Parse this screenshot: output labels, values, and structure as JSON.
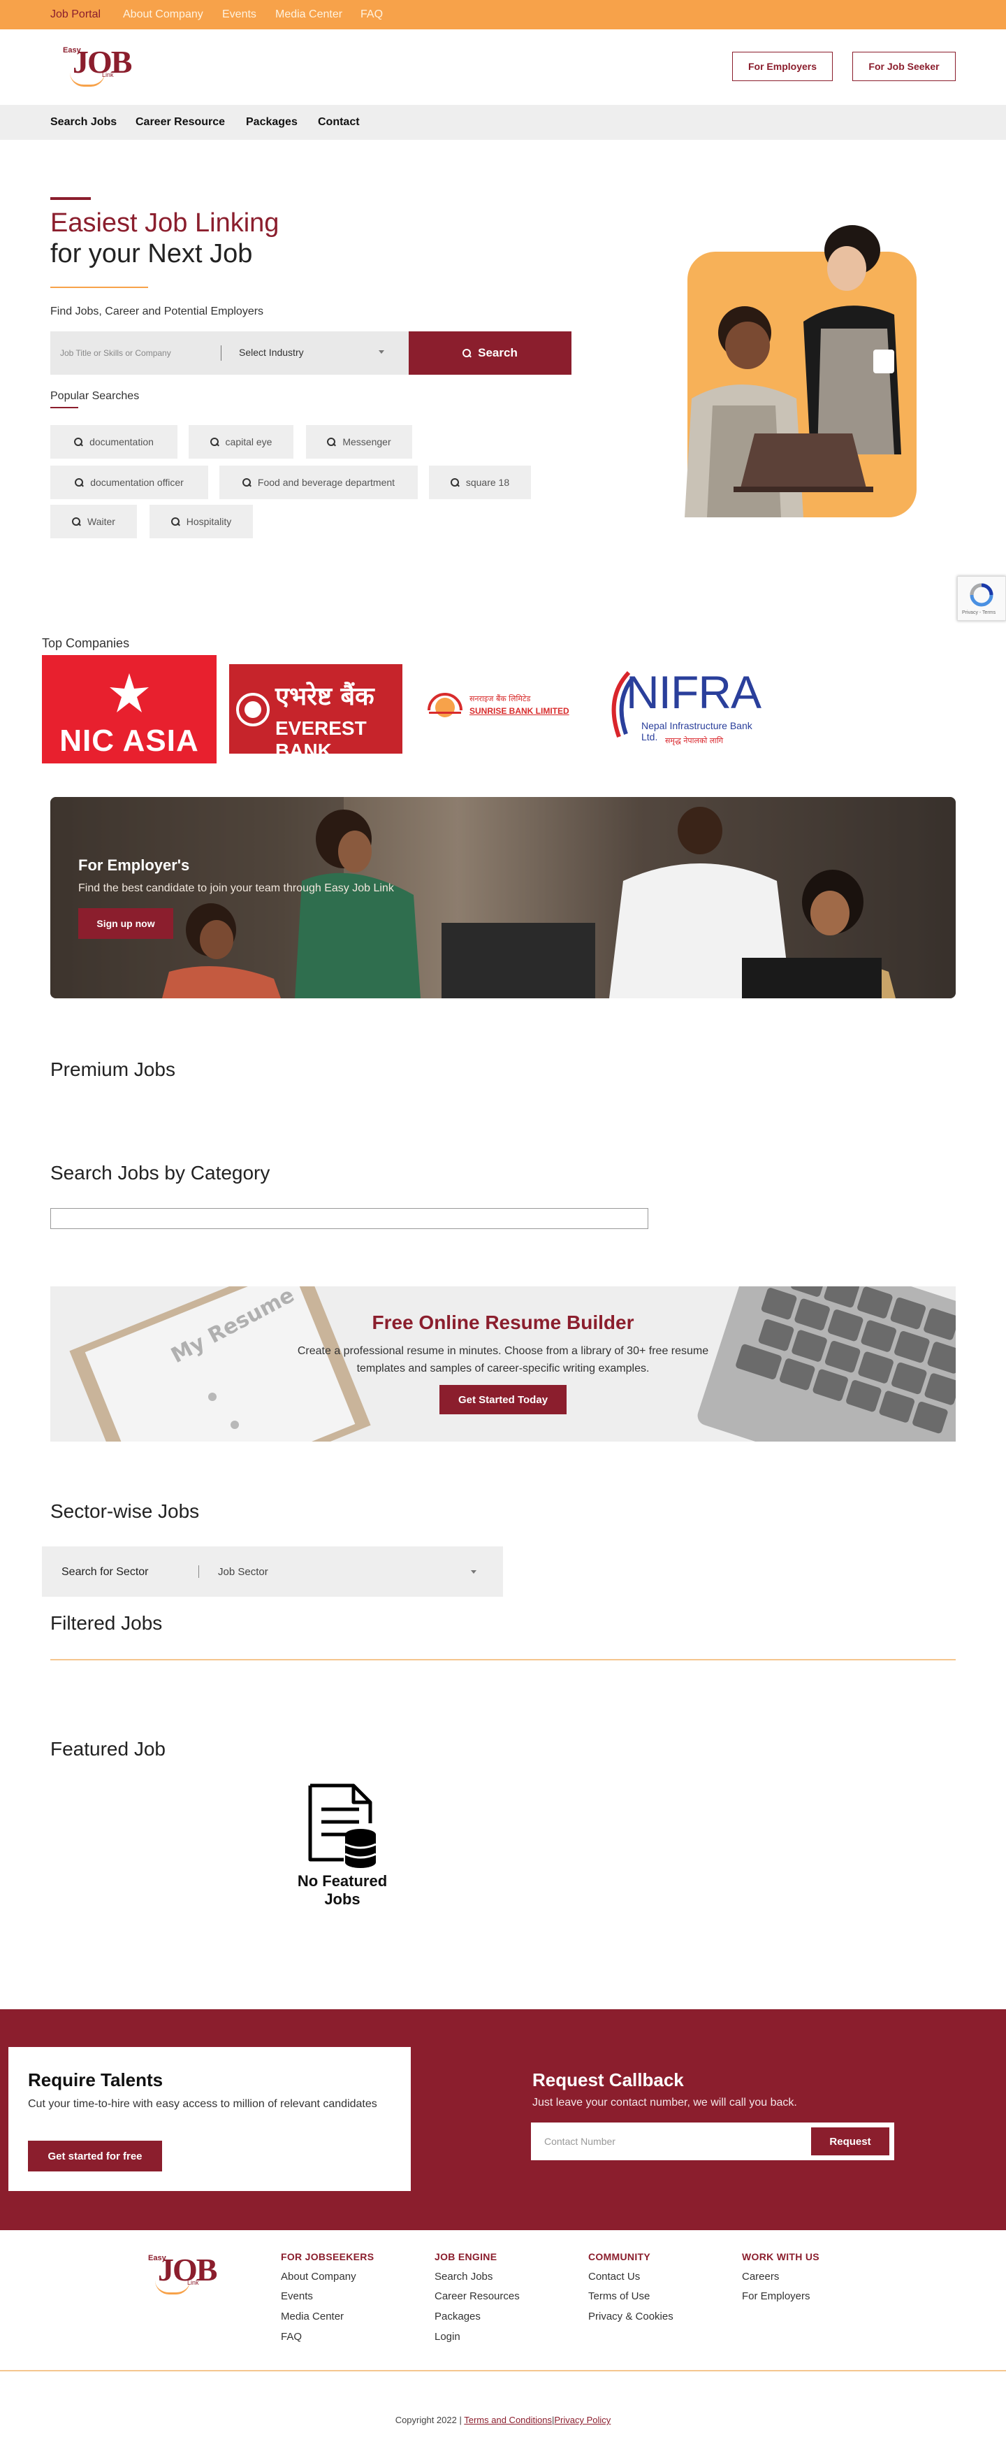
{
  "topbar": {
    "links": [
      "Job Portal",
      "About Company",
      "Events",
      "Media Center",
      "FAQ"
    ]
  },
  "header": {
    "logo": {
      "easy": "Easy",
      "job": "JOB",
      "link": "Link"
    },
    "employers_button": "For Employers",
    "jobseeker_button": "For Job Seeker"
  },
  "nav": {
    "items": [
      "Search Jobs",
      "Career Resource",
      "Packages",
      "Contact"
    ]
  },
  "hero": {
    "title_line1": "Easiest Job Linking",
    "title_line2": "for your Next Job",
    "subtitle": "Find Jobs, Career and Potential Employers",
    "search": {
      "keyword_placeholder": "Job Title or Skills or Company",
      "industry_select": "Select Industry",
      "search_button": "Search"
    },
    "popular_title": "Popular Searches",
    "popular": [
      "documentation",
      "capital eye",
      "Messenger",
      "documentation officer",
      "Food and beverage department",
      "square 18",
      "Waiter",
      "Hospitality"
    ]
  },
  "recaptcha": {
    "text": "Privacy - Terms"
  },
  "companies": {
    "title": "Top Companies",
    "nic": "NIC ASIA",
    "everest_devanagari": "एभरेष्ट बैंक",
    "everest": "EVEREST BANK",
    "sunrise_devanagari": "सनराइज बैंक लिमिटेड",
    "sunrise": "SUNRISE BANK LIMITED",
    "nifra": "NIFRA",
    "nifra_sub": "Nepal Infrastructure Bank Ltd.",
    "nifra_tag": "समृद्ध नेपालको लागि"
  },
  "employer_banner": {
    "title": "For Employer's",
    "subtitle": "Find the best candidate to join your team through Easy Job Link",
    "button": "Sign up now"
  },
  "sections": {
    "premium": "Premium Jobs",
    "category": "Search Jobs by Category",
    "sector": "Sector-wise Jobs",
    "filtered": "Filtered Jobs",
    "featured": "Featured Job"
  },
  "resume": {
    "title": "Free Online Resume Builder",
    "text": "Create a professional resume in minutes. Choose from a library of 30+ free resume templates and samples of career-specific writing examples.",
    "button": "Get Started Today",
    "paper_label": "My Resume"
  },
  "sector": {
    "label": "Search for Sector",
    "select": "Job Sector"
  },
  "featured": {
    "empty_text": "No Featured Jobs"
  },
  "talent": {
    "title": "Require Talents",
    "text": "Cut your time-to-hire with easy access to million of relevant candidates",
    "button": "Get started for free"
  },
  "callback": {
    "title": "Request Callback",
    "text": "Just leave your contact number, we will call you back.",
    "placeholder": "Contact Number",
    "button": "Request"
  },
  "footer": {
    "columns": [
      {
        "heading": "FOR JOBSEEKERS",
        "links": [
          "About Company",
          "Events",
          "Media Center",
          "FAQ"
        ]
      },
      {
        "heading": "JOB ENGINE",
        "links": [
          "Search Jobs",
          "Career Resources",
          "Packages",
          "Login"
        ]
      },
      {
        "heading": "COMMUNITY",
        "links": [
          "Contact Us",
          "Terms of Use",
          "Privacy & Cookies"
        ]
      },
      {
        "heading": "WORK WITH US",
        "links": [
          "Careers",
          "For Employers"
        ]
      }
    ],
    "copyright": "Copyright 2022 |",
    "terms": "Terms and Conditions",
    "sep": "|",
    "privacy": "Privacy Policy"
  },
  "colors": {
    "brand": "#8b1e2d",
    "accent": "#f7a24a",
    "nic_red": "#e8202e",
    "everest_red": "#c6242b",
    "nifra_blue": "#2a3f9b"
  }
}
